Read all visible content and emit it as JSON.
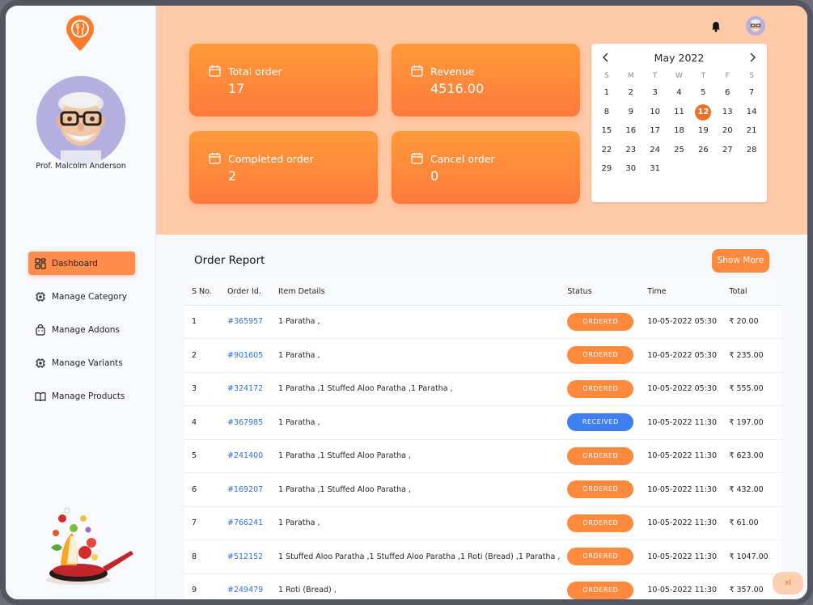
{
  "profile": {
    "name": "Prof. Malcolm Anderson"
  },
  "sidebar": {
    "items": [
      {
        "label": "Dashboard",
        "icon": "dashboard-grid-icon",
        "active": true
      },
      {
        "label": "Manage Category",
        "icon": "chip-icon",
        "active": false
      },
      {
        "label": "Manage Addons",
        "icon": "bag-icon",
        "active": false
      },
      {
        "label": "Manage Variants",
        "icon": "chip-icon",
        "active": false
      },
      {
        "label": "Manage Products",
        "icon": "book-icon",
        "active": false
      }
    ]
  },
  "stats": {
    "total_order": {
      "label": "Total order",
      "value": "17"
    },
    "revenue": {
      "label": "Revenue",
      "value": "4516.00"
    },
    "completed_order": {
      "label": "Completed order",
      "value": "2"
    },
    "cancel_order": {
      "label": "Cancel order",
      "value": "0"
    }
  },
  "calendar": {
    "month_label": "May 2022",
    "weekdays": [
      "S",
      "M",
      "T",
      "W",
      "T",
      "F",
      "S"
    ],
    "first_weekday_offset": 0,
    "days_in_month": 31,
    "selected_day": 12
  },
  "report": {
    "title": "Order Report",
    "show_more_label": "Show More",
    "columns": [
      "S No.",
      "Order Id.",
      "Item Details",
      "Status",
      "Time",
      "Total"
    ],
    "rows": [
      {
        "sno": "1",
        "order_id": "#365957",
        "items": "1 Paratha ,",
        "status": "ORDERED",
        "time": "10-05-2022 05:30",
        "total": "₹ 20.00"
      },
      {
        "sno": "2",
        "order_id": "#901605",
        "items": "1 Paratha ,",
        "status": "ORDERED",
        "time": "10-05-2022 05:30",
        "total": "₹ 235.00"
      },
      {
        "sno": "3",
        "order_id": "#324172",
        "items": "1 Paratha ,1 Stuffed Aloo Paratha ,1 Paratha ,",
        "status": "ORDERED",
        "time": "10-05-2022 05:30",
        "total": "₹ 555.00"
      },
      {
        "sno": "4",
        "order_id": "#367985",
        "items": "1 Paratha ,",
        "status": "RECEIVED",
        "time": "10-05-2022 11:30",
        "total": "₹ 197.00"
      },
      {
        "sno": "5",
        "order_id": "#241400",
        "items": "1 Paratha ,1 Stuffed Aloo Paratha ,",
        "status": "ORDERED",
        "time": "10-05-2022 11:30",
        "total": "₹ 623.00"
      },
      {
        "sno": "6",
        "order_id": "#169207",
        "items": "1 Paratha ,1 Stuffed Aloo Paratha ,",
        "status": "ORDERED",
        "time": "10-05-2022 11:30",
        "total": "₹ 432.00"
      },
      {
        "sno": "7",
        "order_id": "#766241",
        "items": "1 Paratha ,",
        "status": "ORDERED",
        "time": "10-05-2022 11:30",
        "total": "₹ 61.00"
      },
      {
        "sno": "8",
        "order_id": "#512152",
        "items": "1 Stuffed Aloo Paratha ,1 Stuffed Aloo Paratha ,1 Roti (Bread) ,1 Paratha ,",
        "status": "ORDERED",
        "time": "10-05-2022 11:30",
        "total": "₹ 1047.00"
      },
      {
        "sno": "9",
        "order_id": "#249479",
        "items": "1 Roti (Bread) ,",
        "status": "ORDERED",
        "time": "10-05-2022 11:30",
        "total": "₹ 357.00"
      }
    ]
  },
  "corner_button_label": "xl",
  "colors": {
    "accent": "#ff8a3e",
    "header_bg": "#ffcaa8",
    "received": "#3d7ef0",
    "link": "#2f6fd6"
  }
}
